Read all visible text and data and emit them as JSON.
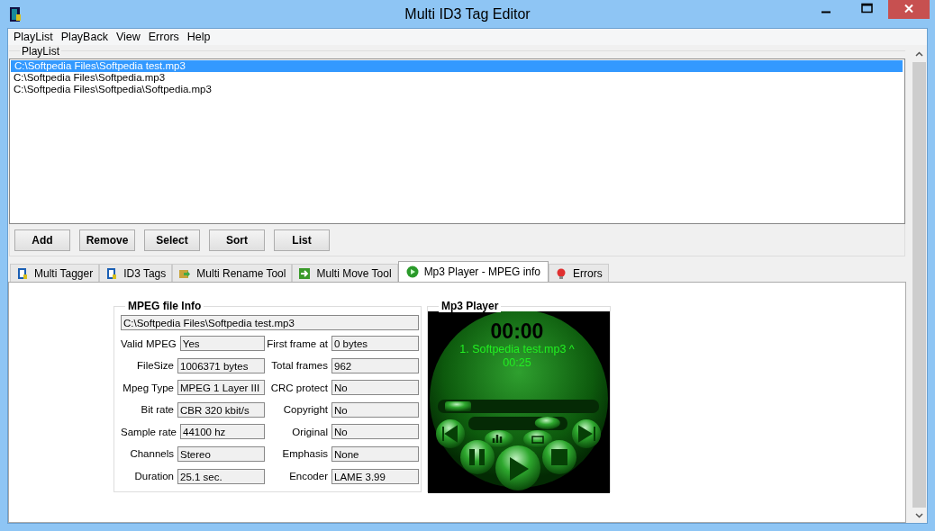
{
  "window": {
    "title": "Multi ID3 Tag Editor"
  },
  "menu": [
    "PlayList",
    "PlayBack",
    "View",
    "Errors",
    "Help"
  ],
  "playlist": {
    "legend": "PlayList",
    "files": [
      {
        "path": "C:\\Softpedia Files\\Softpedia test.mp3",
        "selected": true
      },
      {
        "path": "C:\\Softpedia Files\\Softpedia.mp3",
        "selected": false
      },
      {
        "path": "C:\\Softpedia Files\\Softpedia\\Softpedia.mp3",
        "selected": false
      }
    ]
  },
  "buttons": [
    "Add",
    "Remove",
    "Select",
    "Sort",
    "List"
  ],
  "tabs": [
    {
      "label": "Multi Tagger",
      "kind": "tagger",
      "selected": false
    },
    {
      "label": "ID3 Tags",
      "kind": "id3",
      "selected": false
    },
    {
      "label": "Multi Rename Tool",
      "kind": "rename",
      "selected": false
    },
    {
      "label": "Multi Move Tool",
      "kind": "move",
      "selected": false
    },
    {
      "label": "Mp3 Player - MPEG info",
      "kind": "player",
      "selected": true
    },
    {
      "label": "Errors",
      "kind": "errors",
      "selected": false
    }
  ],
  "mpeg_info": {
    "legend": "MPEG file Info",
    "path": "C:\\Softpedia Files\\Softpedia test.mp3",
    "fields": [
      {
        "label": "Valid MPEG",
        "value": "Yes"
      },
      {
        "label": "First frame at",
        "value": "0 bytes"
      },
      {
        "label": "FileSize",
        "value": "1006371 bytes"
      },
      {
        "label": "Total frames",
        "value": "962"
      },
      {
        "label": "Mpeg Type",
        "value": "MPEG 1 Layer III"
      },
      {
        "label": "CRC protect",
        "value": "No"
      },
      {
        "label": "Bit rate",
        "value": "CBR 320 kbit/s"
      },
      {
        "label": "Copyright",
        "value": "No"
      },
      {
        "label": "Sample rate",
        "value": "44100 hz"
      },
      {
        "label": "Original",
        "value": "No"
      },
      {
        "label": "Channels",
        "value": "Stereo"
      },
      {
        "label": "Emphasis",
        "value": "None"
      },
      {
        "label": "Duration",
        "value": "25.1 sec."
      },
      {
        "label": "Encoder",
        "value": "LAME 3.99"
      }
    ]
  },
  "player": {
    "legend": "Mp3 Player",
    "time": "00:00",
    "track": "1. Softpedia test.mp3 ^",
    "length": "00:25",
    "progress": {
      "level": 0
    },
    "balance": {
      "level": 0.8
    }
  }
}
